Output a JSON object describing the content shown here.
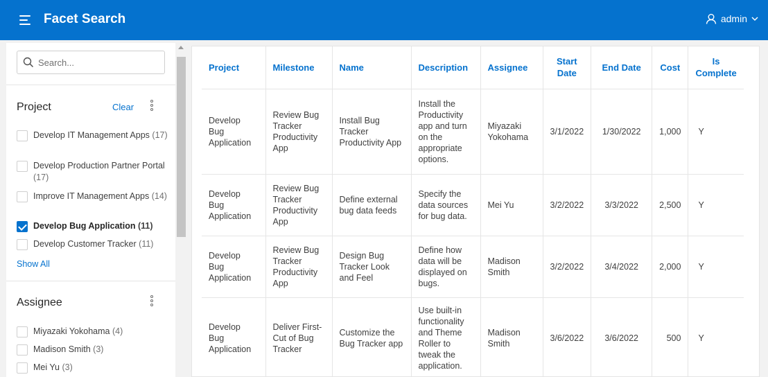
{
  "header": {
    "title": "Facet Search",
    "user": "admin"
  },
  "search": {
    "placeholder": "Search..."
  },
  "facets": {
    "project": {
      "title": "Project",
      "clear_label": "Clear",
      "show_all_label": "Show All",
      "items": [
        {
          "label": "Develop IT Management Apps",
          "count": "(17)",
          "checked": false
        },
        {
          "label": "Develop Production Partner Portal",
          "count": "(17)",
          "checked": false
        },
        {
          "label": "Improve IT Management Apps",
          "count": "(14)",
          "checked": false
        },
        {
          "label": "Develop Bug Application",
          "count": "(11)",
          "checked": true
        },
        {
          "label": "Develop Customer Tracker",
          "count": "(11)",
          "checked": false
        }
      ]
    },
    "assignee": {
      "title": "Assignee",
      "items": [
        {
          "label": "Miyazaki Yokohama",
          "count": "(4)",
          "checked": false
        },
        {
          "label": "Madison Smith",
          "count": "(3)",
          "checked": false
        },
        {
          "label": "Mei Yu",
          "count": "(3)",
          "checked": false
        }
      ]
    }
  },
  "table": {
    "columns": [
      "Project",
      "Milestone",
      "Name",
      "Description",
      "Assignee",
      "Start Date",
      "End Date",
      "Cost",
      "Is Complete"
    ],
    "rows": [
      {
        "project": "Develop Bug Application",
        "milestone": "Review Bug Tracker Productivity App",
        "name": "Install Bug Tracker Productivity App",
        "description": "Install the Productivity app and turn on the appropriate options.",
        "assignee": "Miyazaki Yokohama",
        "start": "3/1/2022",
        "end": "1/30/2022",
        "cost": "1,000",
        "complete": "Y"
      },
      {
        "project": "Develop Bug Application",
        "milestone": "Review Bug Tracker Productivity App",
        "name": "Define external bug data feeds",
        "description": "Specify the data sources for bug data.",
        "assignee": "Mei Yu",
        "start": "3/2/2022",
        "end": "3/3/2022",
        "cost": "2,500",
        "complete": "Y"
      },
      {
        "project": "Develop Bug Application",
        "milestone": "Review Bug Tracker Productivity App",
        "name": "Design Bug Tracker Look and Feel",
        "description": "Define how data will be displayed on bugs.",
        "assignee": "Madison Smith",
        "start": "3/2/2022",
        "end": "3/4/2022",
        "cost": "2,000",
        "complete": "Y"
      },
      {
        "project": "Develop Bug Application",
        "milestone": "Deliver First-Cut of Bug Tracker",
        "name": "Customize the Bug Tracker app",
        "description": "Use built-in functionality and Theme Roller to tweak the application.",
        "assignee": "Madison Smith",
        "start": "3/6/2022",
        "end": "3/6/2022",
        "cost": "500",
        "complete": "Y"
      }
    ]
  },
  "colors": {
    "header_bg": "#0572ce",
    "link": "#0572ce",
    "page_bg": "#f2f2f2"
  }
}
